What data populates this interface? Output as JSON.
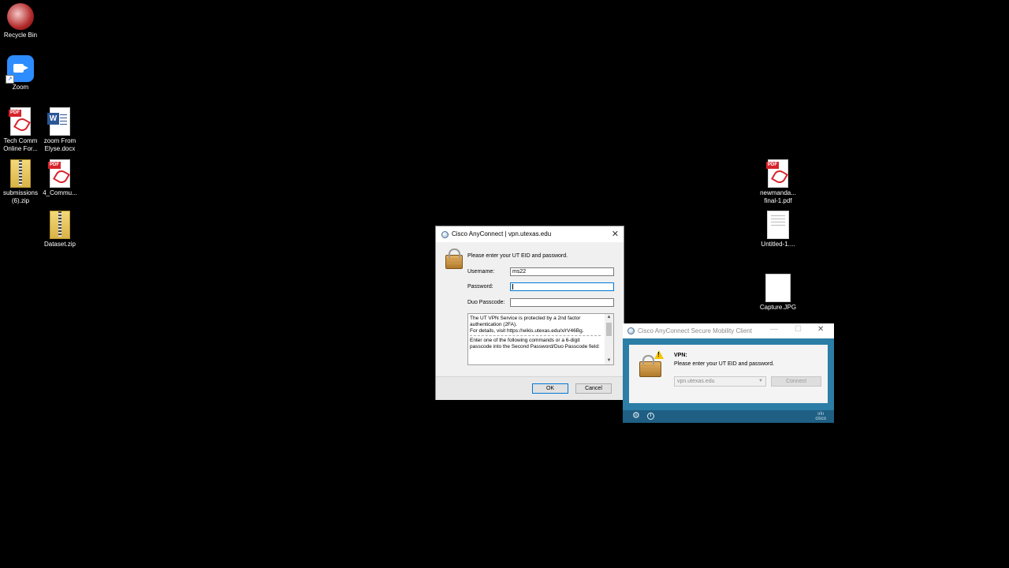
{
  "desktop": {
    "icons": [
      {
        "label": "Recycle Bin",
        "icon": "recycle-bin-icon"
      },
      {
        "label": "Zoom",
        "icon": "zoom-app-icon"
      },
      {
        "label": "Tech Comm Online For...",
        "icon": "pdf-file-icon"
      },
      {
        "label": "zoom From Elyse.docx",
        "icon": "word-file-icon"
      },
      {
        "label": "submissions (6).zip",
        "icon": "zip-folder-icon"
      },
      {
        "label": "4_Commu...",
        "icon": "pdf-file-icon"
      },
      {
        "label": "Dataset.zip",
        "icon": "zip-folder-icon"
      },
      {
        "label": "newmanda... final-1.pdf",
        "icon": "pdf-file-icon"
      },
      {
        "label": "Untitled-1....",
        "icon": "document-file-icon"
      },
      {
        "label": "Capture.JPG",
        "icon": "image-file-icon"
      }
    ]
  },
  "login_dialog": {
    "title": "Cisco AnyConnect | vpn.utexas.edu",
    "prompt": "Please enter your UT EID and password.",
    "username_label": "Username:",
    "username_value": "ms22",
    "password_label": "Password:",
    "password_value": "",
    "duo_label": "Duo Passcode:",
    "duo_value": "",
    "info_lines": [
      "The UT VPN Service is protected by a 2nd factor authentication (2FA).",
      "For details, visit https://wikis.utexas.edu/x/rV46Bg.",
      "Enter one of the following commands or a 6-digit passcode into the Second Password/Duo Passcode field:"
    ],
    "ok_label": "OK",
    "cancel_label": "Cancel"
  },
  "client_window": {
    "title": "Cisco AnyConnect Secure Mobility Client",
    "vpn_label": "VPN:",
    "vpn_message": "Please enter your UT EID and password.",
    "server": "vpn.utexas.edu",
    "connect_label": "Connect",
    "logo_text": "cisco"
  },
  "colors": {
    "desktop_bg": "#000000",
    "client_accent": "#2c7ea6",
    "focus_border": "#0078d7"
  }
}
